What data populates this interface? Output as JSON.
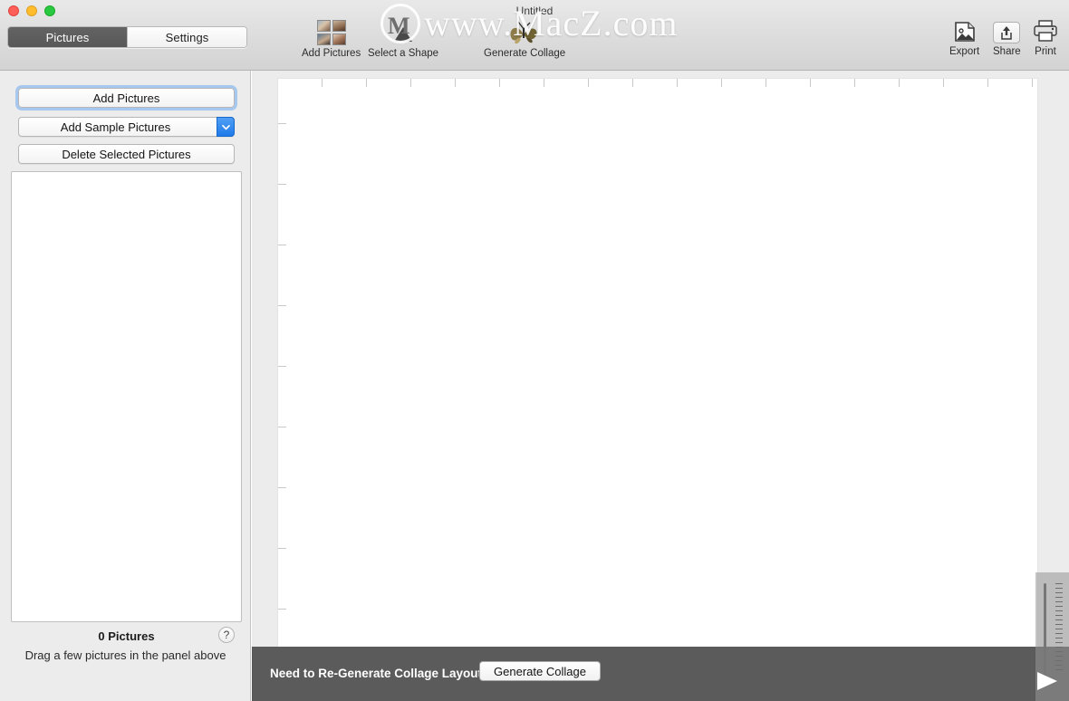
{
  "window": {
    "document_title": "Untitled",
    "traffic_lights": [
      "close-button",
      "minimize-button",
      "zoom-button"
    ]
  },
  "tabs": {
    "items": [
      {
        "label": "Pictures",
        "active": true
      },
      {
        "label": "Settings",
        "active": false
      }
    ]
  },
  "toolbar": {
    "items": [
      {
        "label": "Add Pictures",
        "icon": "photo-grid-icon"
      },
      {
        "label": "Select a Shape",
        "icon": "triangle-shape-icon"
      },
      {
        "label": "Generate Collage",
        "icon": "butterfly-icon"
      }
    ],
    "right_items": [
      {
        "label": "Export",
        "icon": "export-image-icon"
      },
      {
        "label": "Share",
        "icon": "share-arrow-icon"
      },
      {
        "label": "Print",
        "icon": "printer-icon"
      }
    ]
  },
  "watermark": {
    "text": "www.MacZ.com",
    "logo_letter": "M"
  },
  "sidebar": {
    "add_pictures_label": "Add Pictures",
    "add_sample_pictures_label": "Add Sample Pictures",
    "delete_selected_label": "Delete Selected Pictures",
    "dropdown_glyph": "chevron-down-icon",
    "picture_count": "0 Pictures",
    "help_glyph": "?",
    "hint": "Drag a few pictures in the panel above"
  },
  "bottom_bar": {
    "status": "Need to Re-Generate Collage Layout",
    "button_label": "Generate Collage"
  },
  "zoom_control": {
    "name": "zoom-slider",
    "tick_count": 20
  },
  "colors": {
    "accent_blue": "#1f7ae8",
    "focus_ring": "#a7c8ee",
    "bottom_bar": "#5b5b5b",
    "chrome": "#e9e9e9",
    "sidebar": "#ececec",
    "active_tab": "#5d5d5d"
  },
  "ruler": {
    "h_tick_start": 355,
    "h_tick_spacing": 49,
    "h_tick_count": 17,
    "v_tick_start": 136,
    "v_tick_spacing": 67,
    "v_tick_count": 10
  }
}
